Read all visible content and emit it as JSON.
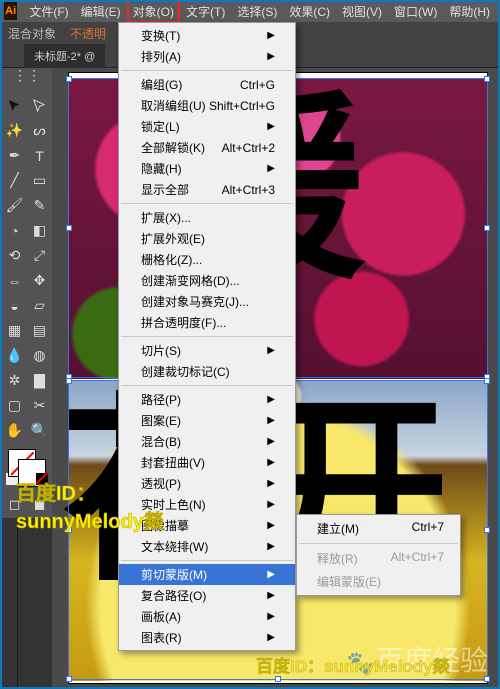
{
  "menubar": {
    "logo": "Ai",
    "items": [
      "文件(F)",
      "编辑(E)",
      "对象(O)",
      "文字(T)",
      "选择(S)",
      "效果(C)",
      "视图(V)",
      "窗口(W)",
      "帮助(H)"
    ],
    "highlighted_index": 2
  },
  "optionsbar": {
    "label1": "混合对象",
    "label2": "不透明"
  },
  "tab": {
    "title": "未标题-2* @"
  },
  "dropdown": {
    "items": [
      {
        "label": "变换(T)",
        "sub": true
      },
      {
        "label": "排列(A)",
        "sub": true
      },
      {
        "sep": true
      },
      {
        "label": "编组(G)",
        "shortcut": "Ctrl+G"
      },
      {
        "label": "取消编组(U)",
        "shortcut": "Shift+Ctrl+G"
      },
      {
        "label": "锁定(L)",
        "sub": true
      },
      {
        "label": "全部解锁(K)",
        "shortcut": "Alt+Ctrl+2"
      },
      {
        "label": "隐藏(H)",
        "sub": true
      },
      {
        "label": "显示全部",
        "shortcut": "Alt+Ctrl+3"
      },
      {
        "sep": true
      },
      {
        "label": "扩展(X)..."
      },
      {
        "label": "扩展外观(E)"
      },
      {
        "label": "栅格化(Z)..."
      },
      {
        "label": "创建渐变网格(D)..."
      },
      {
        "label": "创建对象马赛克(J)..."
      },
      {
        "label": "拼合透明度(F)..."
      },
      {
        "sep": true
      },
      {
        "label": "切片(S)",
        "sub": true
      },
      {
        "label": "创建裁切标记(C)"
      },
      {
        "sep": true
      },
      {
        "label": "路径(P)",
        "sub": true
      },
      {
        "label": "图案(E)",
        "sub": true
      },
      {
        "label": "混合(B)",
        "sub": true
      },
      {
        "label": "封套扭曲(V)",
        "sub": true
      },
      {
        "label": "透视(P)",
        "sub": true
      },
      {
        "label": "实时上色(N)",
        "sub": true
      },
      {
        "label": "图像描摹",
        "sub": true
      },
      {
        "label": "文本绕排(W)",
        "sub": true
      },
      {
        "sep": true
      },
      {
        "label": "剪切蒙版(M)",
        "sub": true,
        "hover": true
      },
      {
        "label": "复合路径(O)",
        "sub": true
      },
      {
        "label": "画板(A)",
        "sub": true
      },
      {
        "label": "图表(R)",
        "sub": true
      }
    ]
  },
  "submenu": {
    "items": [
      {
        "label": "建立(M)",
        "shortcut": "Ctrl+7"
      },
      {
        "label": "释放(R)",
        "shortcut": "Alt+Ctrl+7",
        "dim": true
      },
      {
        "label": "编辑蒙版(E)",
        "dim": true
      }
    ]
  },
  "artboard": {
    "text1": "暖",
    "text2": "花开"
  },
  "annotation": {
    "line1": "百度ID：",
    "line2": "sunnyMelody燚",
    "bottom": "百度ID：sunnyMelody燚"
  },
  "watermark": {
    "text": "百度经验",
    "paw": "🐾"
  }
}
